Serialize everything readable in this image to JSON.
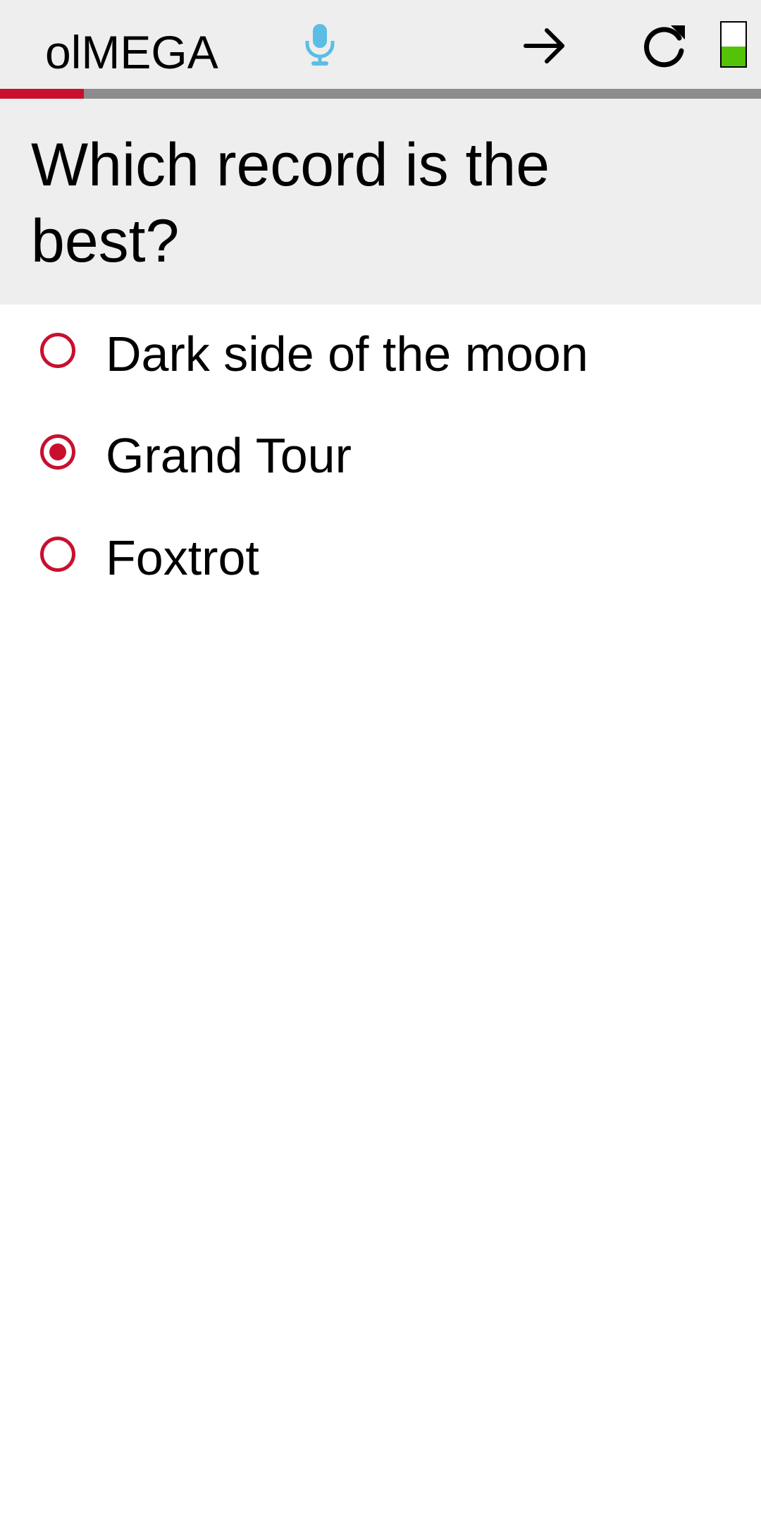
{
  "app": {
    "title": "olMEGA"
  },
  "toolbar": {
    "mic_icon": "mic-icon",
    "next_icon": "arrow-right-icon",
    "refresh_icon": "refresh-icon",
    "battery_icon": "battery-icon",
    "battery_level": 0.45
  },
  "progress": {
    "fraction": 0.11
  },
  "question": {
    "text": "Which record is the best?"
  },
  "options": [
    {
      "label": "Dark side of the moon",
      "selected": false
    },
    {
      "label": "Grand Tour",
      "selected": true
    },
    {
      "label": "Foxtrot",
      "selected": false
    }
  ],
  "colors": {
    "accent": "#c8102e",
    "mic": "#5bbde4",
    "battery": "#54c206",
    "progress_track": "#8c8c8c",
    "header_bg": "#eeeeee"
  }
}
